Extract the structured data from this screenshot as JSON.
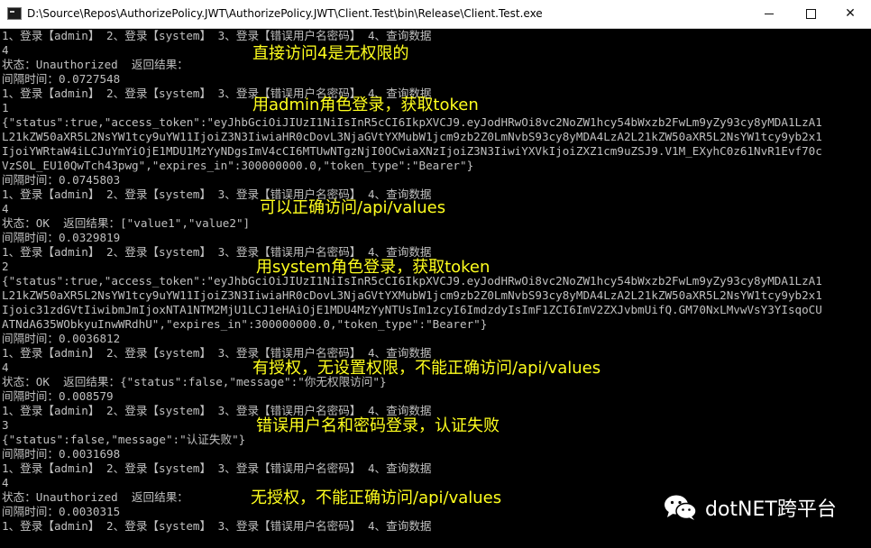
{
  "window": {
    "title": "D:\\Source\\Repos\\AuthorizePolicy.JWT\\AuthorizePolicy.JWT\\Client.Test\\bin\\Release\\Client.Test.exe",
    "minimize_glyph": "",
    "maximize_glyph": "",
    "close_glyph": "✕"
  },
  "console": {
    "lines": [
      "1、登录【admin】 2、登录【system】 3、登录【错误用户名密码】 4、查询数据",
      "4",
      "状态：Unauthorized  返回结果：",
      "间隔时间：0.0727548",
      "1、登录【admin】 2、登录【system】 3、登录【错误用户名密码】 4、查询数据",
      "1",
      "{\"status\":true,\"access_token\":\"eyJhbGciOiJIUzI1NiIsInR5cCI6IkpXVCJ9.eyJodHRwOi8vc2NoZW1hcy54bWxzb2FwLm9yZy93cy8yMDA1LzA1",
      "L21kZW50aXR5L2NsYW1tcy9uYW11IjoiZ3N3IiwiaHR0cDovL3NjaGVtYXMubW1jcm9zb2Z0LmNvbS93cy8yMDA4LzA2L21kZW50aXR5L2NsYW1tcy9yb2x1",
      "IjoiYWRtaW4iLCJuYmYiOjE1MDU1MzYyNDgsImV4cCI6MTUwNTgzNjI0OCwiaXNzIjoiZ3N3IiwiYXVkIjoiZXZ1cm9uZSJ9.V1M_EXyhC0z61NvR1Evf70c",
      "VzS0L_EU10QwTch43pwg\",\"expires_in\":300000000.0,\"token_type\":\"Bearer\"}",
      "间隔时间：0.0745803",
      "1、登录【admin】 2、登录【system】 3、登录【错误用户名密码】 4、查询数据",
      "4",
      "状态：OK  返回结果：[\"value1\",\"value2\"]",
      "间隔时间：0.0329819",
      "1、登录【admin】 2、登录【system】 3、登录【错误用户名密码】 4、查询数据",
      "2",
      "{\"status\":true,\"access_token\":\"eyJhbGciOiJIUzI1NiIsInR5cCI6IkpXVCJ9.eyJodHRwOi8vc2NoZW1hcy54bWxzb2FwLm9yZy93cy8yMDA1LzA1",
      "L21kZW50aXR5L2NsYW1tcy9uYW11IjoiZ3N3IiwiaHR0cDovL3NjaGVtYXMubW1jcm9zb2Z0LmNvbS93cy8yMDA4LzA2L21kZW50aXR5L2NsYW1tcy9yb2x1",
      "Ijoic31zdGVtIiwibmJmIjoxNTA1NTM2MjU1LCJ1eHAiOjE1MDU4MzYyNTUsIm1zcyI6ImdzdyIsImF1ZCI6ImV2ZXJvbmUifQ.GM70NxLMvwVsY3YIsqoCU",
      "ATNdA635WObkyuInwWRdhU\",\"expires_in\":300000000.0,\"token_type\":\"Bearer\"}",
      "间隔时间：0.0036812",
      "1、登录【admin】 2、登录【system】 3、登录【错误用户名密码】 4、查询数据",
      "4",
      "状态：OK  返回结果：{\"status\":false,\"message\":\"你无权限访问\"}",
      "间隔时间：0.008579",
      "1、登录【admin】 2、登录【system】 3、登录【错误用户名密码】 4、查询数据",
      "3",
      "{\"status\":false,\"message\":\"认证失败\"}",
      "间隔时间：0.0031698",
      "1、登录【admin】 2、登录【system】 3、登录【错误用户名密码】 4、查询数据",
      "4",
      "状态：Unauthorized  返回结果：",
      "间隔时间：0.0030315",
      "1、登录【admin】 2、登录【system】 3、登录【错误用户名密码】 4、查询数据"
    ]
  },
  "annotations": [
    "直接访问4是无权限的",
    "用admin角色登录，获取token",
    "可以正确访问/api/values",
    "用system角色登录，获取token",
    "有授权，无设置权限，不能正确访问/api/values",
    "错误用户名和密码登录，认证失败",
    "无授权，不能正确访问/api/values"
  ],
  "watermark": {
    "text": "dotNET跨平台",
    "icon": "wechat-icon"
  },
  "colors": {
    "console_background": "#000000",
    "console_text": "#c0c0c0",
    "annotation_text": "#ffff1e"
  }
}
